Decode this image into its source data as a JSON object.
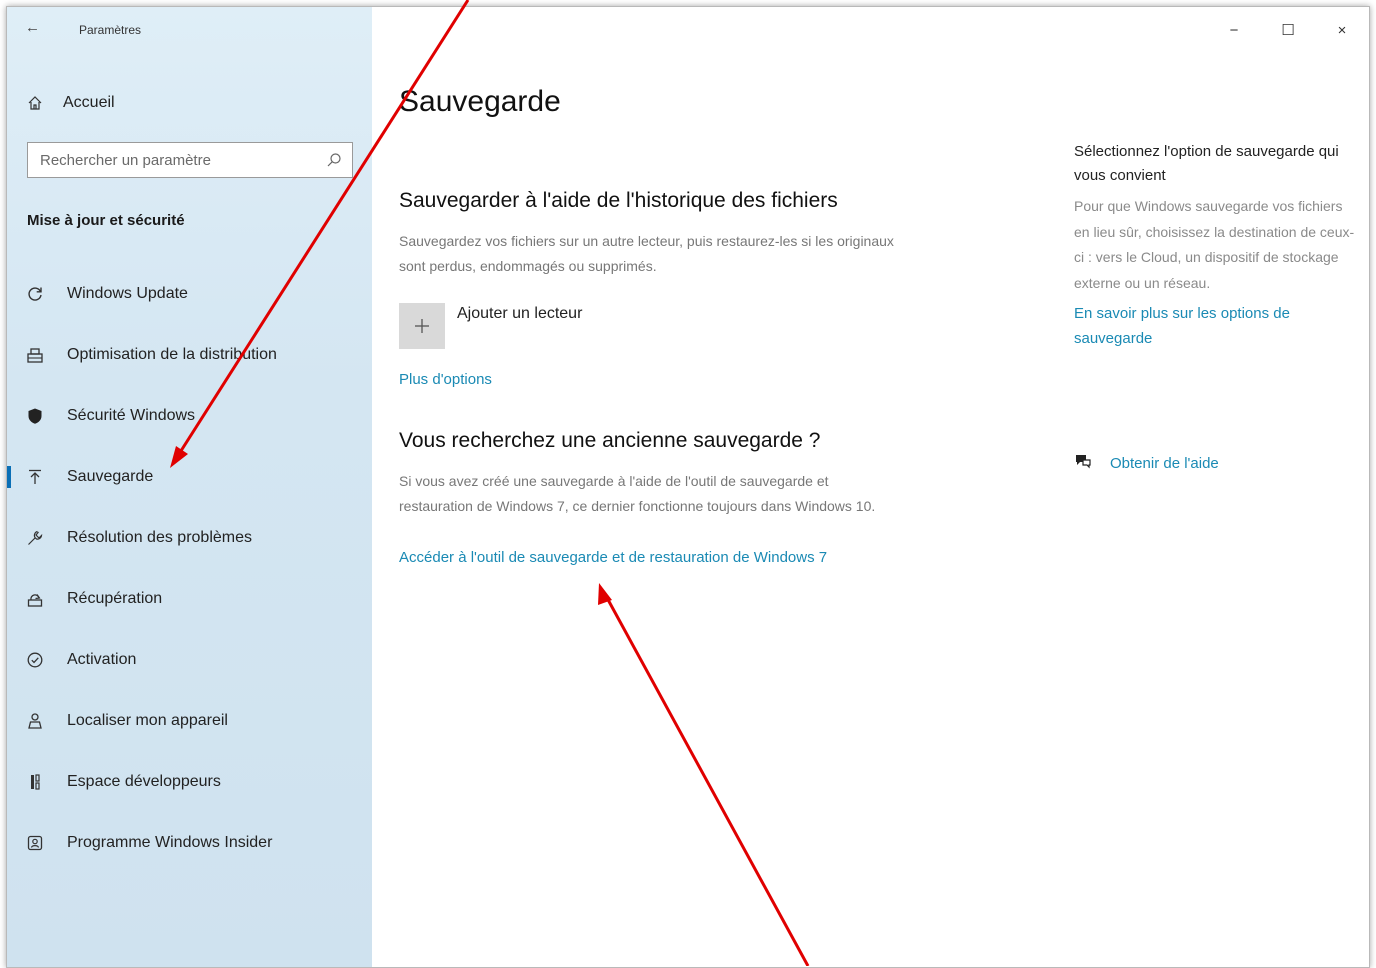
{
  "window": {
    "app_title": "Paramètres",
    "controls": {
      "minimize": "−",
      "maximize": "☐",
      "close": "×"
    }
  },
  "sidebar": {
    "home_label": "Accueil",
    "search": {
      "placeholder": "Rechercher un paramètre",
      "value": ""
    },
    "section_title": "Mise à jour et sécurité",
    "items": [
      {
        "label": "Windows Update",
        "icon": "refresh-icon"
      },
      {
        "label": "Optimisation de la distribution",
        "icon": "delivery-icon"
      },
      {
        "label": "Sécurité Windows",
        "icon": "shield-icon"
      },
      {
        "label": "Sauvegarde",
        "icon": "backup-arrow-icon",
        "active": true
      },
      {
        "label": "Résolution des problèmes",
        "icon": "wrench-icon"
      },
      {
        "label": "Récupération",
        "icon": "recovery-icon"
      },
      {
        "label": "Activation",
        "icon": "check-circle-icon"
      },
      {
        "label": "Localiser mon appareil",
        "icon": "person-pin-icon"
      },
      {
        "label": "Espace développeurs",
        "icon": "developer-icon"
      },
      {
        "label": "Programme Windows Insider",
        "icon": "insider-icon"
      }
    ]
  },
  "main": {
    "title": "Sauvegarde",
    "file_history": {
      "heading": "Sauvegarder à l'aide de l'historique des fichiers",
      "description": "Sauvegardez vos fichiers sur un autre lecteur, puis restaurez-les si les originaux sont perdus, endommagés ou supprimés.",
      "add_drive_label": "Ajouter un lecteur",
      "more_options_link": "Plus d'options"
    },
    "old_backup": {
      "heading": "Vous recherchez une ancienne sauvegarde ?",
      "description": "Si vous avez créé une sauvegarde à l'aide de l'outil de sauvegarde et restauration de Windows 7, ce dernier fonctionne toujours dans Windows 10.",
      "link": "Accéder à l'outil de sauvegarde et de restauration de Windows 7"
    },
    "right_panel": {
      "title": "Sélectionnez l'option de sauvegarde qui vous convient",
      "description": "Pour que Windows sauvegarde vos fichiers en lieu sûr, choisissez la destination de ceux-ci : vers le Cloud, un dispositif de stockage externe ou un réseau.",
      "learn_more_link": "En savoir plus sur les options de sauvegarde",
      "help_link": "Obtenir de l'aide"
    }
  },
  "colors": {
    "accent": "#0a6fb6",
    "link": "#1a8ab4",
    "annotation": "#e00000"
  }
}
